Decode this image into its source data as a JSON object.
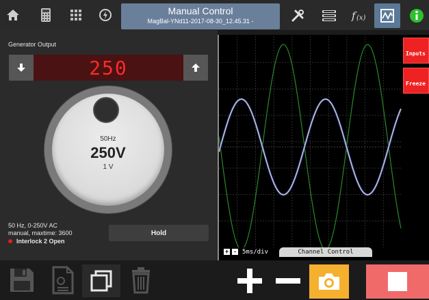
{
  "header": {
    "title": "Manual Control",
    "subtitle": "MagBal-YNd11-2017-08-30_12.45.31 -",
    "icons": [
      "home-icon",
      "calculator-icon",
      "keypad-icon",
      "gauge-icon",
      "tools-icon",
      "sequence-icon",
      "function-icon",
      "oscilloscope-icon",
      "info-icon"
    ]
  },
  "generator": {
    "label": "Generator Output",
    "display_value": "250",
    "knob_frequency": "50Hz",
    "knob_voltage": "250V",
    "knob_measured": "1 V",
    "info_line1": "50 Hz, 0-250V AC",
    "info_line2": "manual, maxtime: 3600",
    "interlock": "Interlock 2 Open",
    "hold_label": "Hold"
  },
  "scope": {
    "inputs_label": "Inputs",
    "freeze_label": "Freeze",
    "zoom_in": "+",
    "zoom_out": "-",
    "timebase": "5ms/div",
    "channel_tab": "Channel Control"
  },
  "colors": {
    "display_text": "#ff2a2a",
    "trace_yellow": "#f4ee3c",
    "trace_blue": "#2a3cff",
    "trace_green": "#2a8a2a",
    "camera_button": "#f5b030",
    "stop_button": "#f06a6a",
    "info_icon": "#2fbf2f"
  },
  "bottom": {
    "icons": [
      "save-icon",
      "document-icon",
      "copy-icon",
      "trash-icon",
      "plus-icon",
      "minus-icon",
      "camera-icon",
      "stop-icon"
    ]
  }
}
